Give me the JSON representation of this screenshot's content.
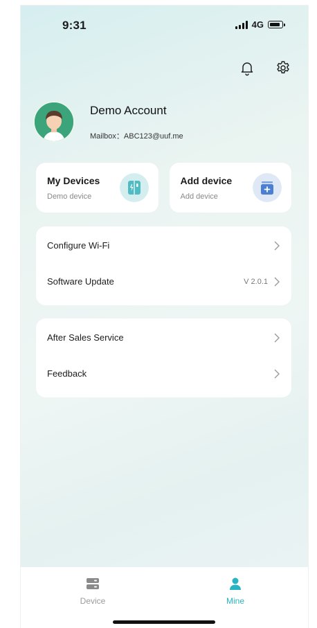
{
  "status_bar": {
    "time": "9:31",
    "network": "4G"
  },
  "profile": {
    "name": "Demo Account",
    "mailbox": "Mailbox：ABC123@uuf.me"
  },
  "cards": [
    {
      "title": "My Devices",
      "subtitle": "Demo device",
      "icon": "device-icon"
    },
    {
      "title": "Add device",
      "subtitle": "Add device",
      "icon": "add-device-icon"
    }
  ],
  "menu_group_1": [
    {
      "label": "Configure Wi-Fi"
    },
    {
      "label": "Software Update",
      "value": "V 2.0.1"
    }
  ],
  "menu_group_2": [
    {
      "label": "After Sales Service"
    },
    {
      "label": "Feedback"
    }
  ],
  "tabs": [
    {
      "label": "Device",
      "icon": "device-tab-icon",
      "active": false
    },
    {
      "label": "Mine",
      "icon": "person-icon",
      "active": true
    }
  ],
  "colors": {
    "accent": "#2ab3c2",
    "inactive": "#9a9a9a"
  }
}
